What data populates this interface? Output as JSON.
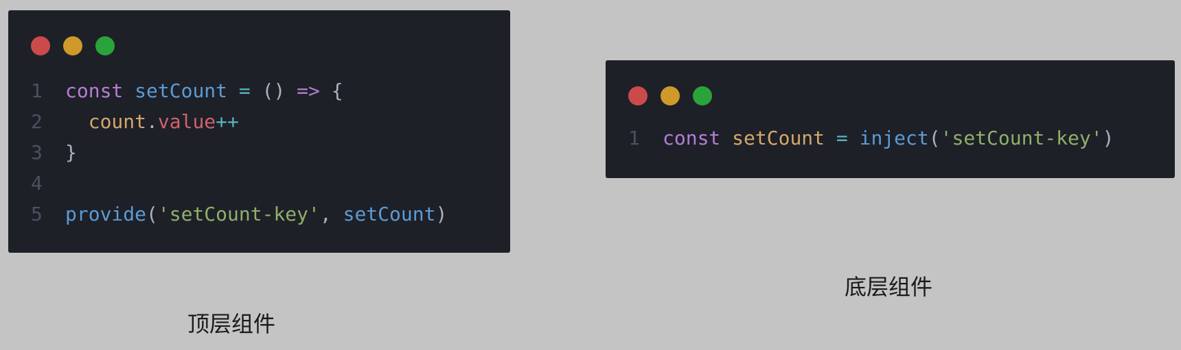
{
  "colors": {
    "page_background": "#c4c4c4",
    "editor_background": "#1e2028",
    "traffic_red": "#cb4b4b",
    "traffic_yellow": "#d09a2a",
    "traffic_green": "#2aa43a",
    "keyword": "#b57ed4",
    "function": "#5b9bd5",
    "variable": "#d4a86a",
    "property": "#d0626a",
    "string": "#8fb06a",
    "operator": "#56b6c2",
    "line_number": "#4b5160"
  },
  "top_window": {
    "caption": "顶层组件",
    "lines": [
      {
        "number": "1",
        "tokens": [
          {
            "text": "const",
            "kind": "keyword"
          },
          {
            "text": " ",
            "kind": "plain"
          },
          {
            "text": "setCount",
            "kind": "func"
          },
          {
            "text": " ",
            "kind": "plain"
          },
          {
            "text": "=",
            "kind": "op"
          },
          {
            "text": " ",
            "kind": "plain"
          },
          {
            "text": "()",
            "kind": "punct"
          },
          {
            "text": " ",
            "kind": "plain"
          },
          {
            "text": "=>",
            "kind": "arrow"
          },
          {
            "text": " ",
            "kind": "plain"
          },
          {
            "text": "{",
            "kind": "punct"
          }
        ]
      },
      {
        "number": "2",
        "tokens": [
          {
            "text": "  ",
            "kind": "plain"
          },
          {
            "text": "count",
            "kind": "var"
          },
          {
            "text": ".",
            "kind": "punct"
          },
          {
            "text": "value",
            "kind": "prop"
          },
          {
            "text": "++",
            "kind": "op"
          }
        ]
      },
      {
        "number": "3",
        "tokens": [
          {
            "text": "}",
            "kind": "punct"
          }
        ]
      },
      {
        "number": "4",
        "tokens": []
      },
      {
        "number": "5",
        "tokens": [
          {
            "text": "provide",
            "kind": "func"
          },
          {
            "text": "(",
            "kind": "punct"
          },
          {
            "text": "'setCount-key'",
            "kind": "string"
          },
          {
            "text": ", ",
            "kind": "punct"
          },
          {
            "text": "setCount",
            "kind": "func"
          },
          {
            "text": ")",
            "kind": "punct"
          }
        ]
      }
    ]
  },
  "bottom_window": {
    "caption": "底层组件",
    "lines": [
      {
        "number": "1",
        "tokens": [
          {
            "text": "const",
            "kind": "keyword"
          },
          {
            "text": " ",
            "kind": "plain"
          },
          {
            "text": "setCount",
            "kind": "var"
          },
          {
            "text": " ",
            "kind": "plain"
          },
          {
            "text": "=",
            "kind": "op"
          },
          {
            "text": " ",
            "kind": "plain"
          },
          {
            "text": "inject",
            "kind": "func"
          },
          {
            "text": "(",
            "kind": "punct"
          },
          {
            "text": "'setCount-key'",
            "kind": "string"
          },
          {
            "text": ")",
            "kind": "punct"
          }
        ]
      }
    ]
  }
}
